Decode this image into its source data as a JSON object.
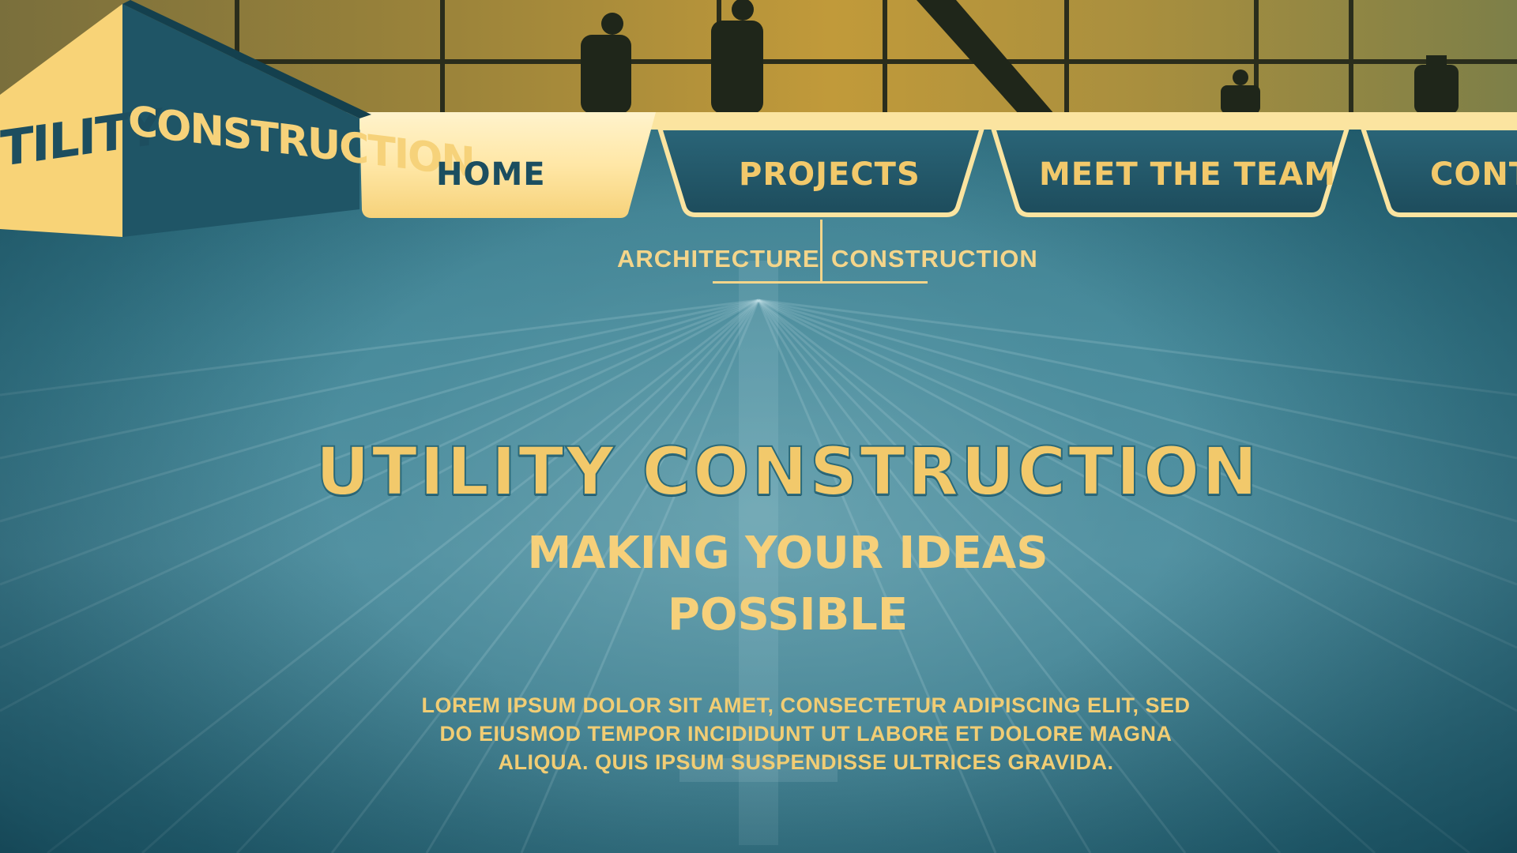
{
  "brand": {
    "logo_text_left": "TILITY",
    "logo_text_right": "CONSTRUCTION"
  },
  "nav": {
    "home": "HOME",
    "projects": "PROJECTS",
    "team": "MEET THE TEAM",
    "contact": "CONT"
  },
  "submenu": {
    "architecture": "ARCHITECTURE",
    "construction": "CONSTRUCTION"
  },
  "hero": {
    "title": "UTILITY CONSTRUCTION",
    "tagline_line1": "MAKING YOUR IDEAS",
    "tagline_line2": "POSSIBLE",
    "body_line1": "LOREM IPSUM DOLOR SIT AMET, CONSECTETUR ADIPISCING ELIT, SED",
    "body_line2": "DO EIUSMOD TEMPOR INCIDIDUNT UT LABORE ET DOLORE MAGNA",
    "body_line3": "ALIQUA. QUIS IPSUM SUSPENDISSE ULTRICES GRAVIDA."
  },
  "colors": {
    "gold": "#f2c96b",
    "teal_dark": "#1b4e60",
    "teal": "#2f6f80"
  }
}
